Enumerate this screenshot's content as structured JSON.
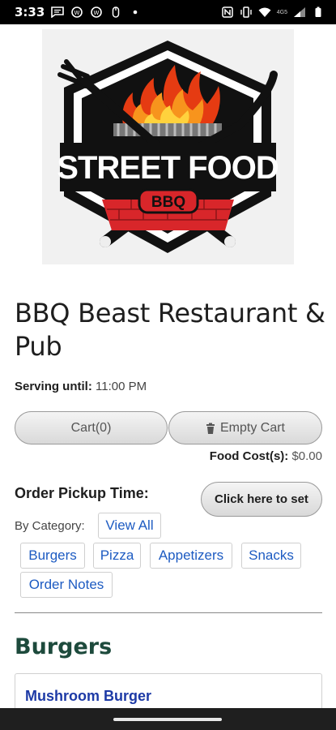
{
  "status_bar": {
    "time": "3:33",
    "left_icons": [
      "message-icon",
      "whatsapp-icon",
      "whatsapp-business-icon",
      "mouse-icon",
      "dot-icon"
    ],
    "right_icons": [
      "nfc-icon",
      "vibrate-icon",
      "wifi-icon",
      "signal-icon",
      "battery-icon"
    ],
    "network": "4G5"
  },
  "logo": {
    "main_text": "STREET FOOD",
    "sub_text": "BBQ"
  },
  "restaurant": {
    "name": "BBQ Beast Restaurant & Pub",
    "serving_label": "Serving until:",
    "serving_value": "11:00 PM"
  },
  "cart": {
    "cart_label": "Cart(0)",
    "empty_label": "Empty Cart",
    "food_cost_label": "Food Cost(s):",
    "food_cost_value": "$0.00"
  },
  "pickup": {
    "label": "Order Pickup Time:",
    "button": "Click here to set"
  },
  "categories": {
    "label": "By Category:",
    "items": [
      "View All",
      "Burgers",
      "Pizza",
      "Appetizers",
      "Snacks",
      "Order Notes"
    ]
  },
  "menu": {
    "section_title": "Burgers",
    "first_item": "Mushroom Burger"
  },
  "colors": {
    "link": "#1d5bc2",
    "section_heading": "#1d4a3c",
    "item_title": "#1d3aa6",
    "logo_red": "#d8262a"
  }
}
